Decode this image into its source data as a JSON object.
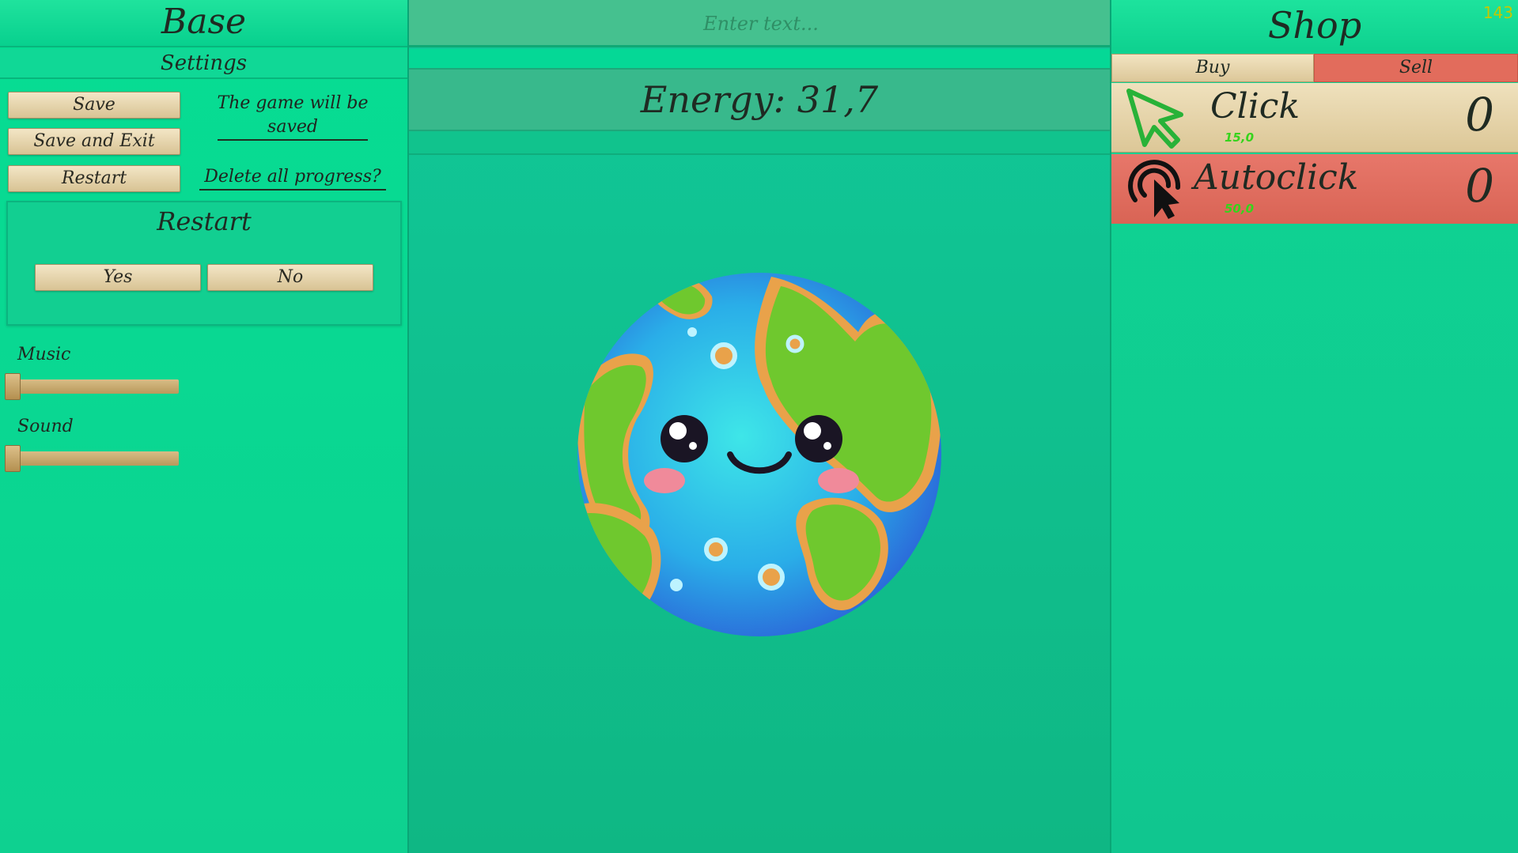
{
  "left_panel": {
    "title": "Base",
    "settings_label": "Settings",
    "buttons": {
      "save": "Save",
      "save_exit": "Save and Exit",
      "restart": "Restart"
    },
    "save_note": "The game will be saved",
    "restart_note": "Delete all progress?",
    "restart_dialog": {
      "title": "Restart",
      "yes": "Yes",
      "no": "No"
    },
    "music_label": "Music",
    "sound_label": "Sound",
    "music_level": 0,
    "sound_level": 0
  },
  "center": {
    "input_placeholder": "Enter text...",
    "energy": "Energy: 31,7"
  },
  "shop": {
    "title": "Shop",
    "fps": "143",
    "tabs": {
      "buy": "Buy",
      "sell": "Sell"
    },
    "items": [
      {
        "name": "Click",
        "price": "15,0",
        "count": "0",
        "icon": "cursor-arrow-icon"
      },
      {
        "name": "Autoclick",
        "price": "50,0",
        "count": "0",
        "icon": "autoclick-icon"
      }
    ]
  },
  "colors": {
    "panel_green": "#0ed190",
    "button_beige": "#e6d4aa",
    "sell_red": "#e26c5c",
    "price_green": "#36d41c",
    "fps_yellow": "#c6c800"
  }
}
